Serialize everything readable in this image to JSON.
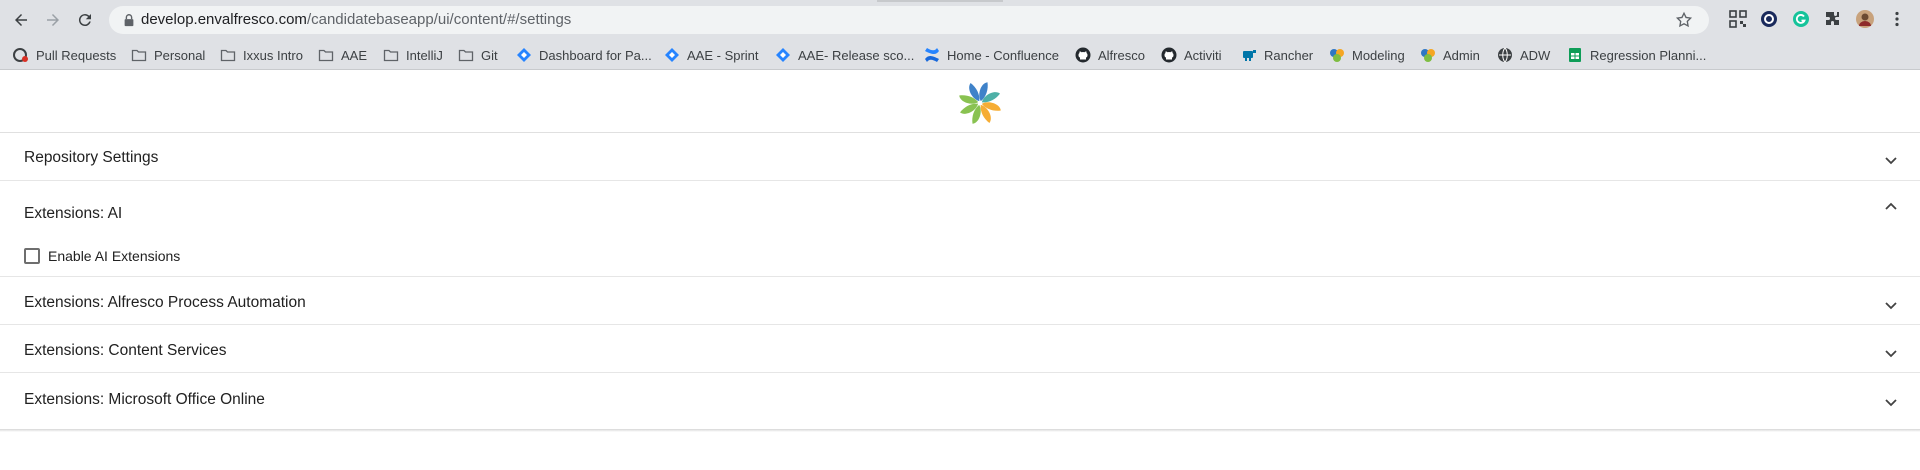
{
  "browser": {
    "url_host": "develop.envalfresco.com",
    "url_path": "/candidatebaseapp/ui/content/#/settings",
    "bookmarks": [
      {
        "label": "Pull Requests",
        "icon": "pull-request-icon"
      },
      {
        "label": "Personal",
        "icon": "folder-icon"
      },
      {
        "label": "Ixxus Intro",
        "icon": "folder-icon"
      },
      {
        "label": "AAE",
        "icon": "folder-icon"
      },
      {
        "label": "IntelliJ",
        "icon": "folder-icon"
      },
      {
        "label": "Git",
        "icon": "folder-icon"
      },
      {
        "label": "Dashboard for Pa...",
        "icon": "jira-icon"
      },
      {
        "label": "AAE - Sprint",
        "icon": "jira-icon"
      },
      {
        "label": "AAE- Release sco...",
        "icon": "jira-icon"
      },
      {
        "label": "Home - Confluence",
        "icon": "confluence-icon"
      },
      {
        "label": "Alfresco",
        "icon": "github-icon"
      },
      {
        "label": "Activiti",
        "icon": "github-icon"
      },
      {
        "label": "Rancher",
        "icon": "rancher-icon"
      },
      {
        "label": "Modeling",
        "icon": "alfresco-icon"
      },
      {
        "label": "Admin",
        "icon": "alfresco-icon"
      },
      {
        "label": "ADW",
        "icon": "globe-icon"
      },
      {
        "label": "Regression Planni...",
        "icon": "sheets-icon"
      }
    ]
  },
  "settings": {
    "panels": [
      {
        "title": "Repository Settings",
        "expanded": false
      },
      {
        "title": "Extensions: AI",
        "expanded": true,
        "checkbox_label": "Enable AI Extensions",
        "checkbox_checked": false
      },
      {
        "title": "Extensions: Alfresco Process Automation",
        "expanded": false
      },
      {
        "title": "Extensions: Content Services",
        "expanded": false
      },
      {
        "title": "Extensions: Microsoft Office Online",
        "expanded": false
      }
    ]
  },
  "colors": {
    "toolbar_bg": "#dfe1e5",
    "omnibox_bg": "#f1f3f4",
    "logo_blue": "#2f77c4",
    "logo_green": "#7fbd42",
    "logo_orange": "#f5a623",
    "logo_teal": "#3fa9a0"
  }
}
